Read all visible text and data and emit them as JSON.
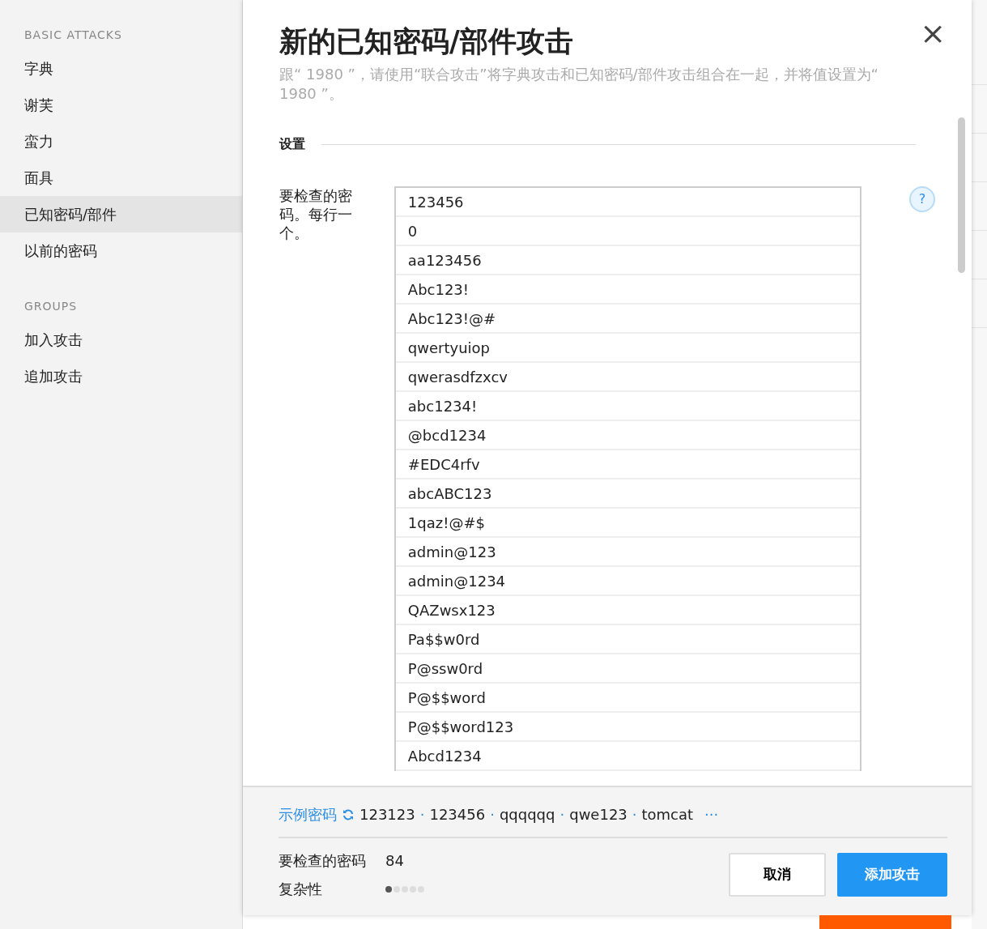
{
  "sidebar": {
    "sections": [
      {
        "heading": "BASIC ATTACKS",
        "items": [
          {
            "label": "字典",
            "selected": false
          },
          {
            "label": "谢芙",
            "selected": false
          },
          {
            "label": "蛮力",
            "selected": false
          },
          {
            "label": "面具",
            "selected": false
          },
          {
            "label": "已知密码/部件",
            "selected": true
          },
          {
            "label": "以前的密码",
            "selected": false
          }
        ]
      },
      {
        "heading": "GROUPS",
        "items": [
          {
            "label": "加入攻击",
            "selected": false
          },
          {
            "label": "追加攻击",
            "selected": false
          }
        ]
      }
    ]
  },
  "dialog": {
    "title": "新的已知密码/部件攻击",
    "close": "×",
    "description": "跟“ 1980 ”，请使用“联合攻击”将字典攻击和已知密码/部件攻击组合在一起，并将值设置为“ 1980 ”。",
    "section_title": "设置",
    "field_label": "要检查的密码。每行一个。",
    "help": "?",
    "passwords": [
      "123456",
      "0",
      "aa123456",
      "Abc123!",
      "Abc123!@#",
      "qwertyuiop",
      "qwerasdfzxcv",
      "abc1234!",
      "@bcd1234",
      "#EDC4rfv",
      "abcABC123",
      "1qaz!@#$",
      "admin@123",
      "admin@1234",
      "QAZwsx123",
      "Pa$$w0rd",
      "P@ssw0rd",
      "P@$$word",
      "P@$$word123",
      "Abcd1234"
    ],
    "footer": {
      "sample_link": "示例密码",
      "samples": [
        "123123",
        "123456",
        "qqqqqq",
        "qwe123",
        "tomcat"
      ],
      "separator": "·",
      "more": "···",
      "count_label": "要检查的密码",
      "count": "84",
      "complexity_label": "复杂性",
      "complexity": {
        "stars": 1
      },
      "cancel": "取消",
      "submit": "添加攻击"
    }
  }
}
